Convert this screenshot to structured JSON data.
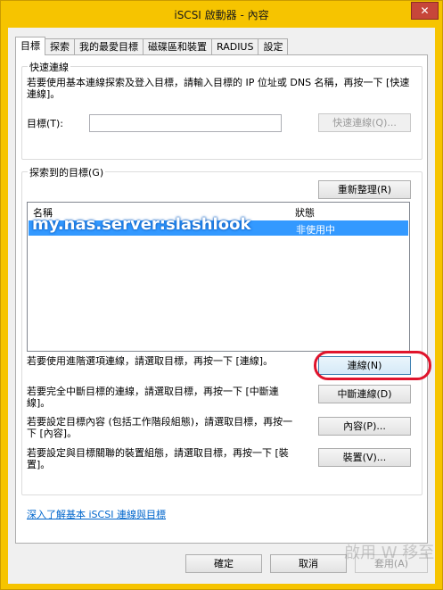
{
  "window": {
    "title": "iSCSI 啟動器 - 內容",
    "close": "✕"
  },
  "tabs": [
    {
      "label": "目標",
      "active": true
    },
    {
      "label": "探索",
      "active": false
    },
    {
      "label": "我的最愛目標",
      "active": false
    },
    {
      "label": "磁碟區和裝置",
      "active": false
    },
    {
      "label": "RADIUS",
      "active": false
    },
    {
      "label": "設定",
      "active": false
    }
  ],
  "quick_connect": {
    "legend": "快速連線",
    "description": "若要使用基本連線探索及登入目標，請輸入目標的 IP 位址或 DNS 名稱，再按一下 [快速連線]。",
    "target_label": "目標(T):",
    "target_value": "",
    "button": "快速連線(Q)..."
  },
  "discovered": {
    "legend": "探索到的目標(G)",
    "refresh_button": "重新整理(R)",
    "columns": {
      "name": "名稱",
      "status": "狀態"
    },
    "rows": [
      {
        "name": "my.nas.server:slashlook",
        "status": "非使用中",
        "selected": true
      }
    ]
  },
  "actions": [
    {
      "text": "若要使用進階選項連線，請選取目標，再按一下 [連線]。",
      "button": "連線(N)"
    },
    {
      "text": "若要完全中斷目標的連線，請選取目標，再按一下 [中斷連線]。",
      "button": "中斷連線(D)"
    },
    {
      "text": "若要設定目標內容 (包括工作階段組態)，請選取目標，再按一下 [內容]。",
      "button": "內容(P)..."
    },
    {
      "text": "若要設定與目標關聯的裝置組態，請選取目標，再按一下 [裝置]。",
      "button": "裝置(V)..."
    }
  ],
  "help_link": "深入了解基本 iSCSI 連線與目標",
  "footer": {
    "ok": "確定",
    "cancel": "取消",
    "apply": "套用(A)"
  },
  "watermark_text": "啟用 W 移至"
}
